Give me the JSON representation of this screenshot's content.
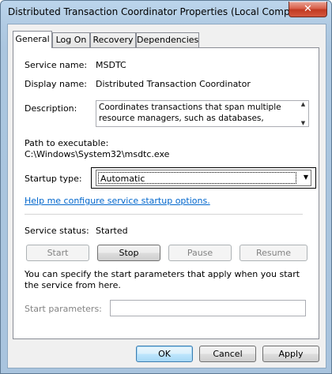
{
  "window": {
    "title": "Distributed Transaction Coordinator Properties (Local Computer)",
    "close_glyph": "✕"
  },
  "tabs": [
    {
      "label": "General",
      "active": true
    },
    {
      "label": "Log On",
      "active": false
    },
    {
      "label": "Recovery",
      "active": false
    },
    {
      "label": "Dependencies",
      "active": false
    }
  ],
  "general": {
    "service_name_label": "Service name:",
    "service_name_value": "MSDTC",
    "display_name_label": "Display name:",
    "display_name_value": "Distributed Transaction Coordinator",
    "description_label": "Description:",
    "description_value": "Coordinates transactions that span multiple resource managers, such as databases, message queues,",
    "path_label": "Path to executable:",
    "path_value": "C:\\Windows\\System32\\msdtc.exe",
    "startup_type_label": "Startup type:",
    "startup_type_value": "Automatic",
    "help_link": "Help me configure service startup options.",
    "service_status_label": "Service status:",
    "service_status_value": "Started",
    "start_button": "Start",
    "stop_button": "Stop",
    "pause_button": "Pause",
    "resume_button": "Resume",
    "start_params_info": "You can specify the start parameters that apply when you start the service from here.",
    "start_params_label": "Start parameters:",
    "start_params_value": ""
  },
  "footer": {
    "ok": "OK",
    "cancel": "Cancel",
    "apply": "Apply"
  },
  "icons": {
    "scroll_up": "▲",
    "scroll_down": "▼",
    "dropdown": "▼"
  }
}
